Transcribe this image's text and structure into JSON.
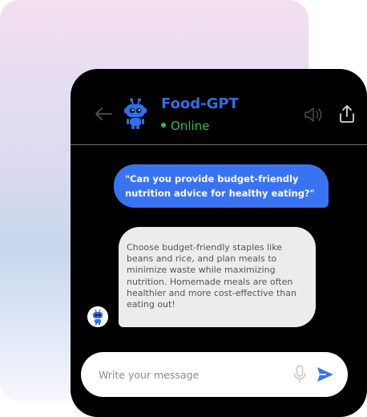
{
  "chat": {
    "bot_name": "Food-GPT",
    "status": "Online",
    "messages": [
      {
        "sender": "user",
        "text": "\"Can you provide budget-friendly nutrition advice for healthy eating?\""
      },
      {
        "sender": "bot",
        "text": "Choose budget-friendly staples like beans and rice, and plan meals to minimize waste while maximizing nutrition. Homemade meals are often healthier and more cost-effective than eating out!"
      }
    ]
  },
  "composer": {
    "placeholder": "Write your message"
  },
  "colors": {
    "accent": "#3a73f2",
    "online": "#27c24a",
    "phone_bg": "#000000",
    "bot_bubble": "#ececec"
  },
  "icons": {
    "back": "arrow-left-icon",
    "avatar": "robot-icon",
    "speaker": "speaker-icon",
    "share": "share-icon",
    "mic": "microphone-icon",
    "send": "send-icon"
  }
}
